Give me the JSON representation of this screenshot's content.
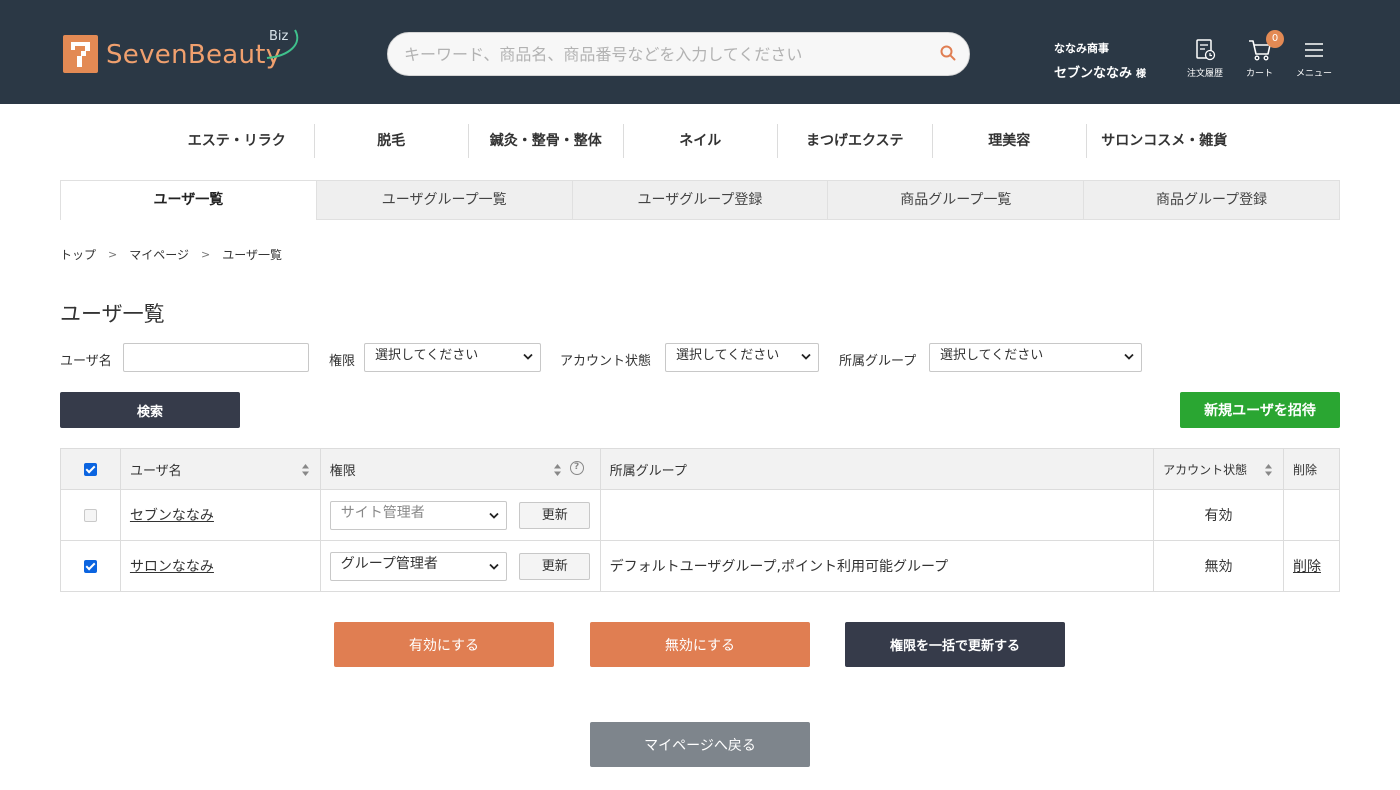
{
  "header": {
    "logo_text": "SevenBeauty",
    "logo_suffix": "Biz",
    "logo_mark": "7",
    "search_placeholder": "キーワード、商品名、商品番号などを入力してください",
    "company": "ななみ商事",
    "user_name": "セブンななみ",
    "honorific": "様",
    "order_history_label": "注文履歴",
    "cart_label": "カート",
    "cart_count": "0",
    "menu_label": "メニュー",
    "colors": {
      "header_bg": "#2b3845",
      "brand_orange": "#e38a54"
    }
  },
  "categories": [
    "エステ・リラク",
    "脱毛",
    "鍼灸・整骨・整体",
    "ネイル",
    "まつげエクステ",
    "理美容",
    "サロンコスメ・雑貨"
  ],
  "tabs": [
    "ユーザ一覧",
    "ユーザグループ一覧",
    "ユーザグループ登録",
    "商品グループ一覧",
    "商品グループ登録"
  ],
  "breadcrumb": [
    "トップ",
    "マイページ",
    "ユーザ一覧"
  ],
  "page_title": "ユーザ一覧",
  "filters": {
    "username_label": "ユーザ名",
    "username_value": "",
    "role_label": "権限",
    "role_value": "選択してください",
    "status_label": "アカウント状態",
    "status_value": "選択してください",
    "group_label": "所属グループ",
    "group_value": "選択してください"
  },
  "search_button": "検索",
  "invite_button": "新規ユーザを招待",
  "table": {
    "headers": {
      "username": "ユーザ名",
      "role": "権限",
      "group": "所属グループ",
      "status": "アカウント状態",
      "delete": "削除"
    },
    "update_label": "更新",
    "rows": [
      {
        "checked": false,
        "username": "セブンななみ",
        "role": "サイト管理者",
        "group": "",
        "status": "有効",
        "delete": ""
      },
      {
        "checked": true,
        "username": "サロンななみ",
        "role": "グループ管理者",
        "group": "デフォルトユーザグループ,ポイント利用可能グループ",
        "status": "無効",
        "delete": "削除"
      }
    ]
  },
  "actions": {
    "enable": "有効にする",
    "disable": "無効にする",
    "bulk_update": "権限を一括で更新する",
    "back": "マイページへ戻る"
  }
}
